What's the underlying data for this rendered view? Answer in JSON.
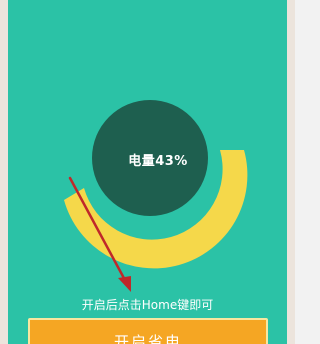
{
  "battery": {
    "label": "电量43%",
    "level_percent": 43
  },
  "hint": {
    "text": "开启后点击Home键即可"
  },
  "action": {
    "start_label": "开启省电"
  },
  "colors": {
    "background": "#2bc2a6",
    "circle": "#1e5f4f",
    "arc": "#f5d84a",
    "button": "#f5a623",
    "arrow": "#c0282a"
  }
}
